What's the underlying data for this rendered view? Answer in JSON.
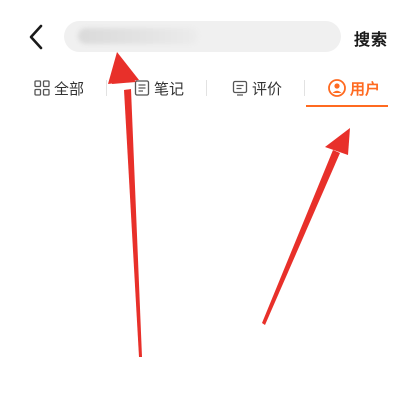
{
  "header": {
    "search_label": "搜索"
  },
  "tabs": [
    {
      "label": "全部",
      "icon": "grid-icon",
      "active": false
    },
    {
      "label": "笔记",
      "icon": "note-icon",
      "active": false
    },
    {
      "label": "评价",
      "icon": "comment-icon",
      "active": false
    },
    {
      "label": "用户",
      "icon": "user-icon",
      "active": true
    }
  ],
  "colors": {
    "accent": "#ff6a20",
    "annotation_arrow": "#e8302a",
    "search_bg": "#f0f0f0"
  }
}
